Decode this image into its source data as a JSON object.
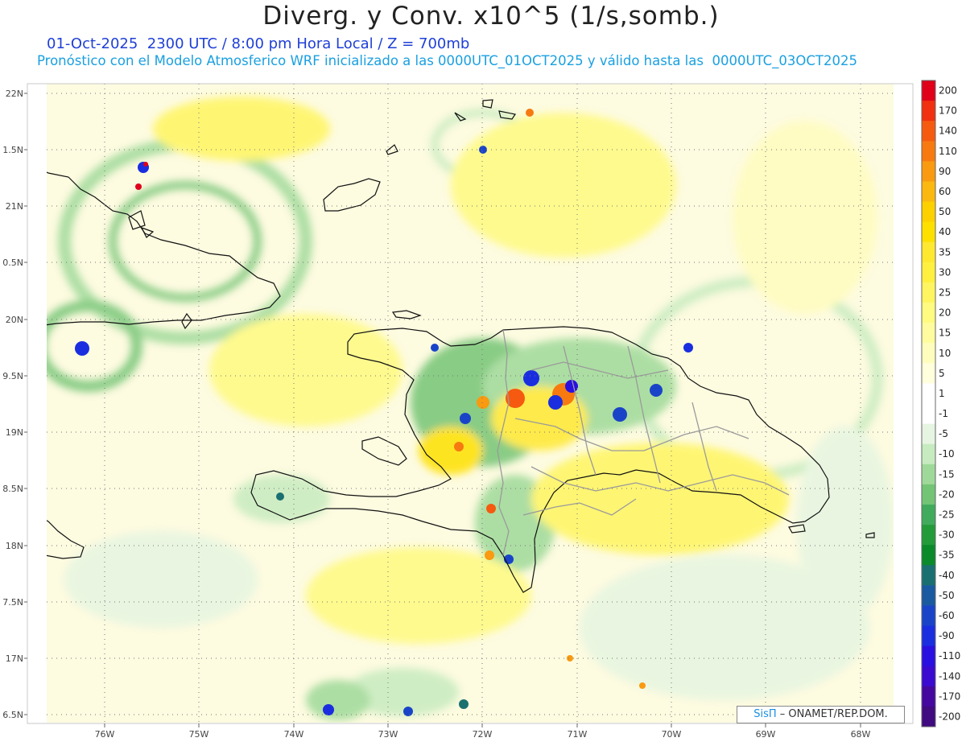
{
  "header": {
    "title": "Diverg. y Conv. x10^5 (1/s,somb.)",
    "subtitle_line1": "01-Oct-2025  2300 UTC / 8:00 pm Hora Local / Z = 700mb",
    "subtitle_line2": "Pronóstico con el Modelo Atmosferico WRF inicializado a las 0000UTC_01OCT2025 y válido hasta las  0000UTC_03OCT2025"
  },
  "map": {
    "lat_labels": [
      "22N",
      "1.5N",
      "21N",
      "0.5N",
      "20N",
      "9.5N",
      "19N",
      "8.5N",
      "18N",
      "7.5N",
      "17N",
      "6.5N"
    ],
    "lon_labels": [
      "76W",
      "75W",
      "74W",
      "73W",
      "72W",
      "71W",
      "70W",
      "69W",
      "68W"
    ]
  },
  "colorbar": {
    "labels": [
      "200",
      "170",
      "140",
      "110",
      "90",
      "60",
      "50",
      "40",
      "35",
      "30",
      "25",
      "20",
      "15",
      "10",
      "5",
      "1",
      "-1",
      "-5",
      "-10",
      "-15",
      "-20",
      "-25",
      "-30",
      "-35",
      "-40",
      "-50",
      "-60",
      "-90",
      "-110",
      "-140",
      "-170",
      "-200"
    ],
    "colors": [
      "#e0001a",
      "#f03010",
      "#f55a10",
      "#f77a10",
      "#f99a10",
      "#fbb810",
      "#fdd000",
      "#fee000",
      "#ffe830",
      "#fff040",
      "#fff560",
      "#fffa80",
      "#fffc9f",
      "#fffdbe",
      "#fffedd",
      "#ffffff",
      "#ffffff",
      "#e6f5e1",
      "#c7ebc0",
      "#9fd999",
      "#74c476",
      "#41ab5d",
      "#239b3a",
      "#0a8a2a",
      "#1a7070",
      "#1a5aa0",
      "#1a44c8",
      "#1a2ee0",
      "#2a10e0",
      "#3a0ad0",
      "#44089f",
      "#400a80"
    ]
  },
  "credit": {
    "brand": "SisΠ",
    "text": " – ONAMET/REP.DOM."
  }
}
